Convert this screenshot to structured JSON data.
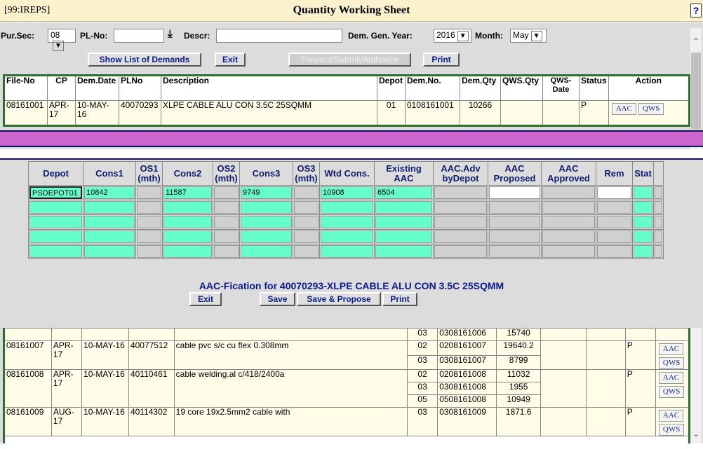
{
  "titlebar": {
    "code": "[99:IREPS]",
    "title": "Quantity Working Sheet",
    "help": "?"
  },
  "filters": {
    "pursec_label": "Pur.Sec:",
    "pursec_value": "08",
    "plno_label": "PL-No:",
    "descr_label": "Descr:",
    "demgen_label": "Dem. Gen. Year:",
    "demgen_value": "2016",
    "month_label": "Month:",
    "month_value": "May"
  },
  "buttons": {
    "show_list": "Show List of Demands",
    "exit": "Exit",
    "forward": "Forward/Submit/Authorize",
    "print": "Print"
  },
  "icons": {
    "plno_picker": "down-arrow-icon",
    "scroll_up": "chevron-up-icon",
    "scroll_down": "chevron-down-icon"
  },
  "colors": {
    "band": "#cc66cc",
    "input_fill": "#66ffcc",
    "title_bg": "#fbf1cd",
    "heading": "#0b1a8c"
  },
  "grid": {
    "headers": [
      "File-No",
      "CP",
      "Dem.Date",
      "PLNo",
      "Description",
      "Depot",
      "Dem.No.",
      "Dem.Qty",
      "QWS.Qty",
      "QWS-Date",
      "Status",
      "Action"
    ],
    "aac_label": "AAC",
    "qws_label": "QWS",
    "top_row": {
      "file": "08161001",
      "cp": "APR-17",
      "date": "10-MAY-16",
      "plno": "40070293",
      "desc": "XLPE CABLE ALU CON 3.5C 25SQMM",
      "depot": "01",
      "demno": "0108161001",
      "qty": "10266",
      "status": "P"
    },
    "rows": [
      {
        "file": "",
        "cp": "",
        "date": "",
        "plno": "",
        "desc": "",
        "status": "",
        "subs": [
          {
            "depot": "03",
            "demno": "0308161006",
            "qty": "15740"
          }
        ]
      },
      {
        "file": "08161007",
        "cp": "APR-17",
        "date": "10-MAY-16",
        "plno": "40077512",
        "desc": "cable pvc s/c cu flex 0.308mm",
        "status": "P",
        "subs": [
          {
            "depot": "02",
            "demno": "0208161007",
            "qty": "19640.2"
          },
          {
            "depot": "03",
            "demno": "0308161007",
            "qty": "8799"
          }
        ]
      },
      {
        "file": "08161008",
        "cp": "APR-17",
        "date": "10-MAY-16",
        "plno": "40110461",
        "desc": "cable welding.al c/418/2400a",
        "status": "P",
        "subs": [
          {
            "depot": "02",
            "demno": "0208161008",
            "qty": "11032"
          },
          {
            "depot": "03",
            "demno": "0308161008",
            "qty": "1955"
          },
          {
            "depot": "05",
            "demno": "0508161008",
            "qty": "10949"
          }
        ]
      },
      {
        "file": "08161009",
        "cp": "AUG-17",
        "date": "10-MAY-16",
        "plno": "40114302",
        "desc": "19 core 19x2.5mm2 cable with",
        "status": "P",
        "subs": [
          {
            "depot": "03",
            "demno": "0308161009",
            "qty": "1871.6"
          }
        ]
      }
    ]
  },
  "modal": {
    "headers": [
      "Depot",
      "Cons1",
      "OS1 (mth)",
      "Cons2",
      "OS2 (mth)",
      "Cons3",
      "OS3 (mth)",
      "Wtd Cons.",
      "Existing AAC",
      "AAC.Adv byDepot",
      "AAC Proposed",
      "AAC Approved",
      "Rem",
      "Stat"
    ],
    "first_row": {
      "depot": "PSDEPOT01",
      "cons1": "10842",
      "cons2": "11587",
      "cons3": "9749",
      "wtd": "10908",
      "existing": "6504"
    },
    "title": "AAC-Fication for 40070293-XLPE CABLE ALU CON 3.5C 25SQMM",
    "buttons": {
      "exit": "Exit",
      "save": "Save",
      "save_propose": "Save & Propose",
      "print": "Print"
    }
  }
}
